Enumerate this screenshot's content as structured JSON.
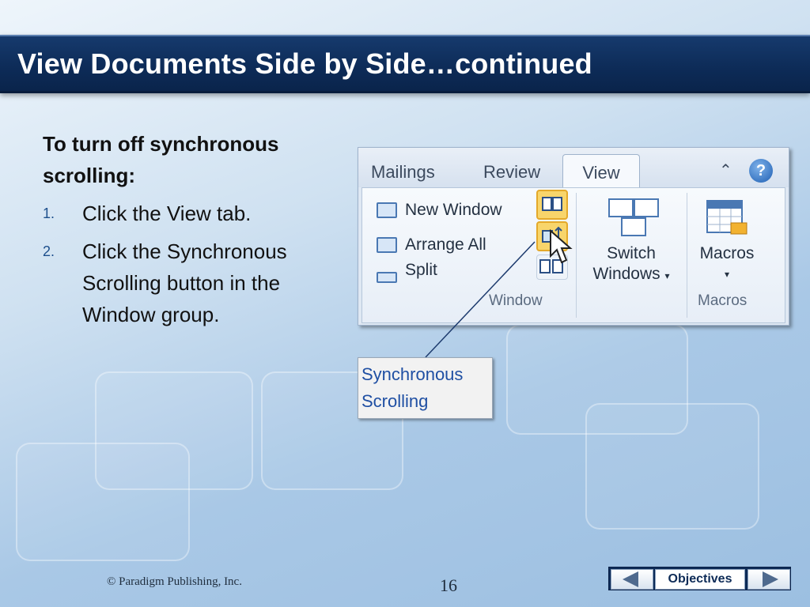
{
  "slide": {
    "title": "View Documents Side by Side…continued",
    "intro": "To turn off synchronous scrolling:",
    "steps": [
      {
        "number": "1.",
        "text": "Click the View tab."
      },
      {
        "number": "2.",
        "text": "Click the Synchronous Scrolling button in the Window group."
      }
    ]
  },
  "ribbon": {
    "tabs": [
      "Mailings",
      "Review",
      "View"
    ],
    "active_tab": "View",
    "help_icon": "?",
    "commands": [
      "New Window",
      "Arrange All",
      "Split"
    ],
    "switch_windows_line1": "Switch",
    "switch_windows_line2": "Windows",
    "macros_label": "Macros",
    "group_window": "Window",
    "group_macros": "Macros"
  },
  "callout": {
    "line1": "Synchronous",
    "line2": "Scrolling"
  },
  "footer": {
    "copyright": "© Paradigm Publishing, Inc.",
    "page": "16",
    "objectives": "Objectives"
  }
}
